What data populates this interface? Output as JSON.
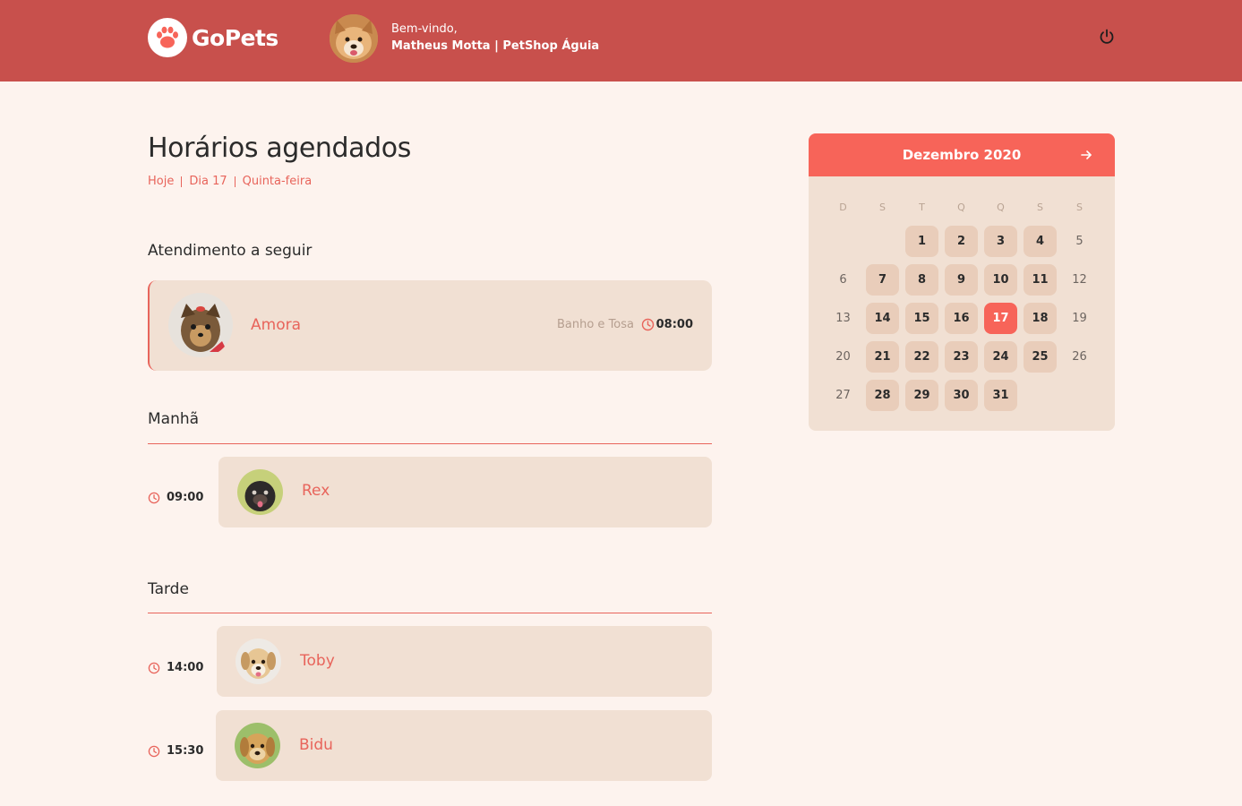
{
  "header": {
    "brand": "GoPets",
    "welcome": "Bem-vindo,",
    "user": "Matheus Motta | PetShop Águia",
    "logout_icon": "power-icon"
  },
  "page": {
    "title": "Horários agendados",
    "subtitle": [
      "Hoje",
      "Dia 17",
      "Quinta-feira"
    ]
  },
  "next": {
    "heading": "Atendimento a seguir",
    "pet": "Amora",
    "service": "Banho e Tosa",
    "time": "08:00"
  },
  "morning": {
    "heading": "Manhã",
    "items": [
      {
        "time": "09:00",
        "pet": "Rex"
      }
    ]
  },
  "afternoon": {
    "heading": "Tarde",
    "items": [
      {
        "time": "14:00",
        "pet": "Toby"
      },
      {
        "time": "15:30",
        "pet": "Bidu"
      }
    ]
  },
  "calendar": {
    "month": "Dezembro 2020",
    "weekdays": [
      "D",
      "S",
      "T",
      "Q",
      "Q",
      "S",
      "S"
    ],
    "first_weekday": 2,
    "days_in_month": 31,
    "selected_day": 17,
    "unavailable_days": [
      5,
      6,
      12,
      13,
      19,
      20,
      26,
      27
    ],
    "accent_color": "#f76459"
  },
  "colors": {
    "header": "#c8504c",
    "background": "#fdf3ee",
    "card": "#f1e0d3",
    "accent": "#e8645b"
  }
}
